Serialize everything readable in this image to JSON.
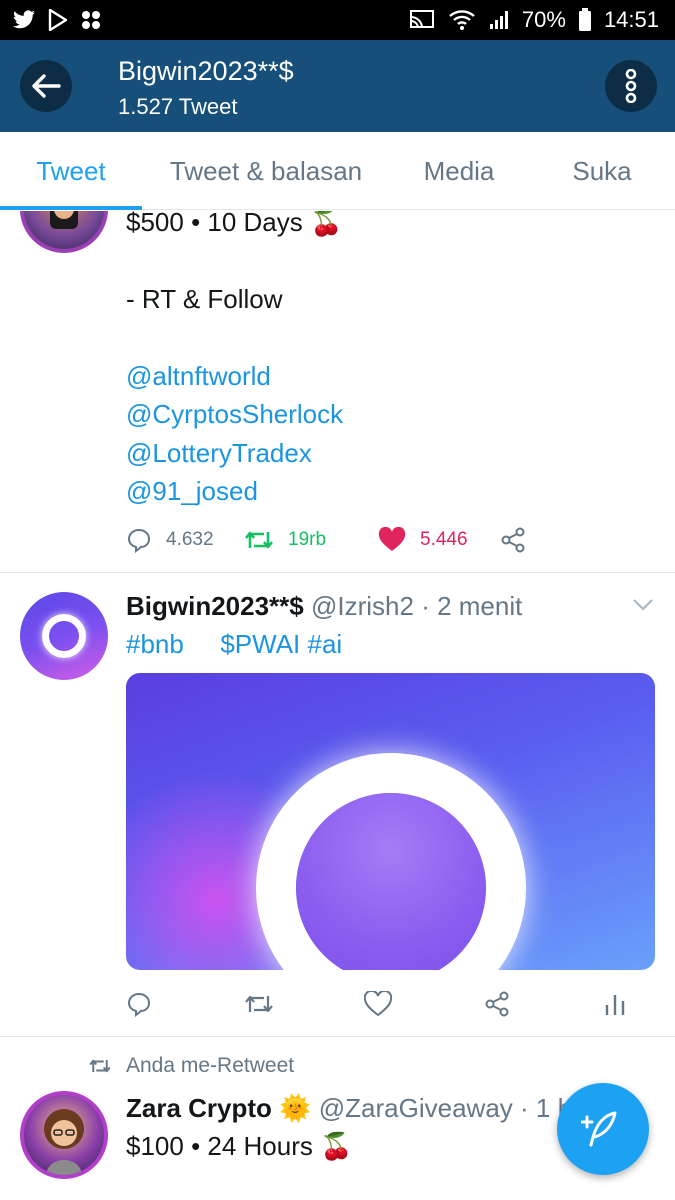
{
  "status_bar": {
    "battery": "70%",
    "time": "14:51",
    "left_icons": [
      "twitter-icon",
      "play-store-icon",
      "apps-icon"
    ],
    "right_icons": [
      "cast-icon",
      "wifi-icon",
      "signal-icon",
      "battery-icon"
    ]
  },
  "header": {
    "title": "Bigwin2023**$",
    "subtitle": "1.527 Tweet",
    "back_icon": "arrow-left-icon",
    "more_icon": "more-vertical-icon"
  },
  "tabs": [
    {
      "label": "Tweet",
      "active": true
    },
    {
      "label": "Tweet & balasan",
      "active": false
    },
    {
      "label": "Media",
      "active": false
    },
    {
      "label": "Suka",
      "active": false
    }
  ],
  "tweet1": {
    "line1": "$500 • 10 Days 🍒",
    "line2": "- RT & Follow",
    "mentions": [
      "@altnftworld",
      "@CyrptosSherlock",
      "@LotteryTradex",
      "@91_josed"
    ],
    "replies": "4.632",
    "retweets": "19rb",
    "likes": "5.446"
  },
  "tweet2": {
    "name": "Bigwin2023**$",
    "handle": "@Izrish2",
    "time": "· 2 menit",
    "hashtags": [
      "#bnb",
      "$PWAI",
      "#ai"
    ]
  },
  "tweet3": {
    "retweet_note": "Anda me-Retweet",
    "name": "Zara Crypto",
    "emoji": "🌞",
    "handle": "@ZaraGiveaway",
    "time": "· 1 har",
    "line1": "$100 • 24 Hours 🍒"
  },
  "colors": {
    "header_bg": "#164f79",
    "accent": "#1da1f2",
    "link": "#1b95e0",
    "retweet": "#17bf63",
    "like": "#e0245e"
  }
}
